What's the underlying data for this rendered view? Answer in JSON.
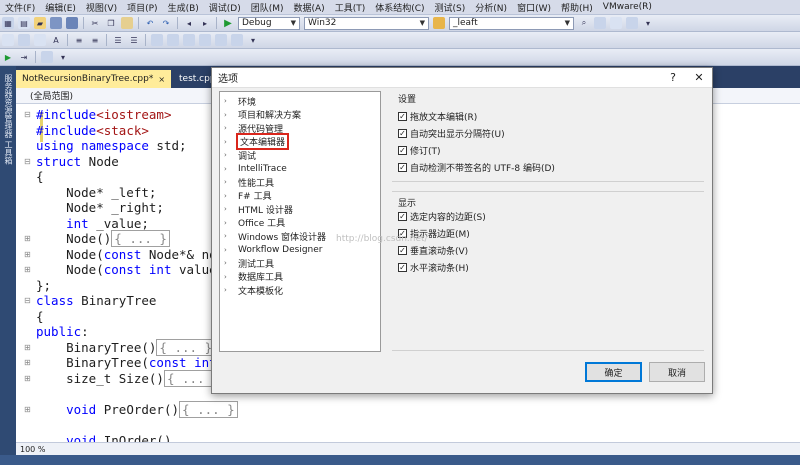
{
  "menu": [
    "文件(F)",
    "编辑(E)",
    "视图(V)",
    "项目(P)",
    "生成(B)",
    "调试(D)",
    "团队(M)",
    "数据(A)",
    "工具(T)",
    "体系结构(C)",
    "测试(S)",
    "分析(N)",
    "窗口(W)",
    "帮助(H)",
    "VMware(R)"
  ],
  "toolbar": {
    "config": "Debug",
    "platform": "Win32",
    "find": "_leaft"
  },
  "left_rail_text": "服务器资源管理器 工具箱",
  "tabs": [
    {
      "label": "NotRecursionBinaryTree.cpp*",
      "close": "×"
    },
    {
      "label": "test.cpp",
      "close": ""
    }
  ],
  "navbar": {
    "scope": "(全局范围)"
  },
  "code": [
    {
      "segs": [
        {
          "t": "#include",
          "c": "kw"
        },
        {
          "t": "<iostream>",
          "c": "pp"
        }
      ]
    },
    {
      "segs": [
        {
          "t": "#include",
          "c": "kw"
        },
        {
          "t": "<stack>",
          "c": "pp"
        }
      ]
    },
    {
      "segs": [
        {
          "t": "using",
          "c": "kw"
        },
        {
          "t": " "
        },
        {
          "t": "namespace",
          "c": "kw"
        },
        {
          "t": " std;"
        }
      ]
    },
    {
      "segs": [
        {
          "t": "struct",
          "c": "kw"
        },
        {
          "t": " Node"
        }
      ]
    },
    {
      "segs": [
        {
          "t": "{"
        }
      ]
    },
    {
      "segs": [
        {
          "t": "    Node* _left;"
        }
      ]
    },
    {
      "segs": [
        {
          "t": "    Node* _right;"
        }
      ]
    },
    {
      "segs": [
        {
          "t": "    "
        },
        {
          "t": "int",
          "c": "kw"
        },
        {
          "t": " _value;"
        }
      ]
    },
    {
      "segs": [
        {
          "t": "    Node()"
        },
        {
          "t": "{ ... }",
          "c": "collapsed"
        }
      ]
    },
    {
      "segs": [
        {
          "t": "    Node("
        },
        {
          "t": "const",
          "c": "kw"
        },
        {
          "t": " Node*& nod"
        }
      ]
    },
    {
      "segs": [
        {
          "t": "    Node("
        },
        {
          "t": "const",
          "c": "kw"
        },
        {
          "t": " "
        },
        {
          "t": "int",
          "c": "kw"
        },
        {
          "t": " value)"
        }
      ]
    },
    {
      "segs": [
        {
          "t": "};"
        }
      ]
    },
    {
      "segs": [
        {
          "t": "class",
          "c": "kw"
        },
        {
          "t": " BinaryTree"
        }
      ]
    },
    {
      "segs": [
        {
          "t": "{"
        }
      ]
    },
    {
      "segs": [
        {
          "t": "public",
          "c": "kw"
        },
        {
          "t": ":"
        }
      ]
    },
    {
      "segs": [
        {
          "t": "    BinaryTree()"
        },
        {
          "t": "{ ... }",
          "c": "collapsed"
        }
      ]
    },
    {
      "segs": [
        {
          "t": "    BinaryTree("
        },
        {
          "t": "const",
          "c": "kw"
        },
        {
          "t": " "
        },
        {
          "t": "int",
          "c": "kw"
        },
        {
          "t": "*"
        }
      ]
    },
    {
      "segs": [
        {
          "t": "    size_t Size()"
        },
        {
          "t": "{ ... }",
          "c": "collapsed"
        }
      ]
    },
    {
      "segs": [
        {
          "t": ""
        }
      ]
    },
    {
      "segs": [
        {
          "t": "    "
        },
        {
          "t": "void",
          "c": "kw"
        },
        {
          "t": " PreOrder()"
        },
        {
          "t": "{ ... }",
          "c": "collapsed"
        }
      ]
    },
    {
      "segs": [
        {
          "t": ""
        }
      ]
    },
    {
      "segs": [
        {
          "t": "    "
        },
        {
          "t": "void",
          "c": "kw"
        },
        {
          "t": " InOrder()"
        }
      ]
    }
  ],
  "status": {
    "zoom": "100 %"
  },
  "dialog": {
    "title": "选项",
    "help": "?",
    "close": "✕",
    "tree": [
      "环境",
      "项目和解决方案",
      "源代码管理",
      "文本编辑器",
      "调试",
      "IntelliTrace",
      "性能工具",
      "F# 工具",
      "HTML 设计器",
      "Office 工具",
      "Windows 窗体设计器",
      "Workflow Designer",
      "测试工具",
      "数据库工具",
      "文本模板化"
    ],
    "selected_tree_item": "文本编辑器",
    "group_settings": {
      "title": "设置",
      "items": [
        {
          "label": "拖放文本编辑(R)",
          "checked": true
        },
        {
          "label": "自动突出显示分隔符(U)",
          "checked": true
        },
        {
          "label": "修订(T)",
          "checked": true
        },
        {
          "label": "自动检测不带签名的 UTF-8 编码(D)",
          "checked": true
        }
      ]
    },
    "group_display": {
      "title": "显示",
      "items": [
        {
          "label": "选定内容的边距(S)",
          "checked": true
        },
        {
          "label": "指示器边距(M)",
          "checked": true
        },
        {
          "label": "垂直滚动条(V)",
          "checked": true
        },
        {
          "label": "水平滚动条(H)",
          "checked": true
        }
      ]
    },
    "ok_label": "确定",
    "cancel_label": "取消",
    "watermark": "http://blog.csdn.net/"
  }
}
